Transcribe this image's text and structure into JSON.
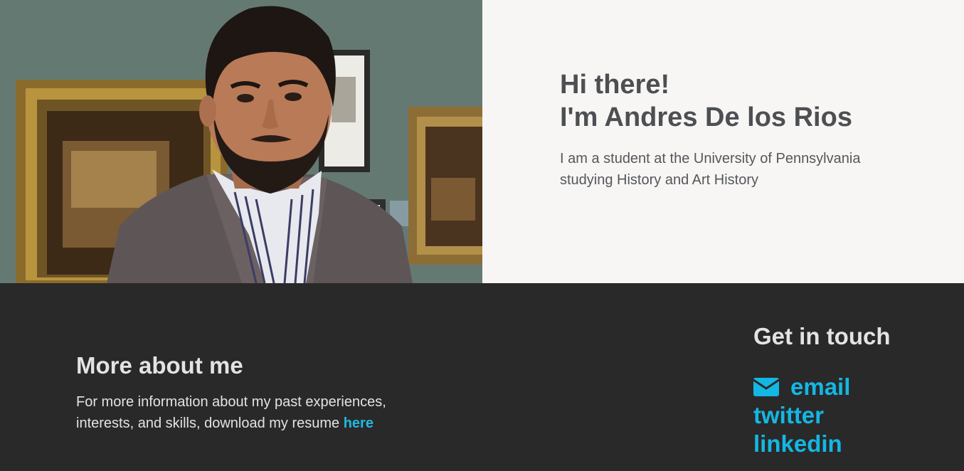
{
  "hero": {
    "photo_alt": "Andres De los Rios in an art museum gallery",
    "greeting": "Hi there!",
    "name_line": "I'm Andres De los Rios",
    "description": "I am a student at the University of Pennsylvania studying History and Art History"
  },
  "about": {
    "title": "More about me",
    "text": "For more information about my past experiences, interests, and skills, download my resume",
    "link_label": "here"
  },
  "contact": {
    "title": "Get in touch",
    "links": [
      {
        "label": "email",
        "icon": "envelope-icon"
      },
      {
        "label": "twitter"
      },
      {
        "label": "linkedin"
      }
    ]
  },
  "colors": {
    "intro_bg": "#f7f6f4",
    "footer_bg": "#292929",
    "accent": "#14b7e3",
    "heading_dark": "#4d4f53",
    "light_text": "#e3e3e3"
  }
}
